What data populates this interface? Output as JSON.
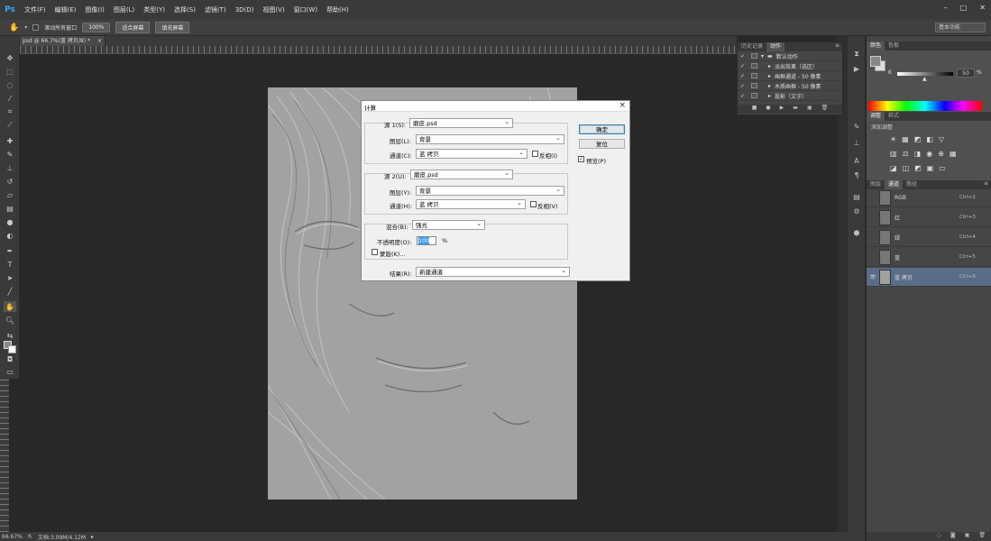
{
  "menubar": {
    "logo": "Ps",
    "items": [
      "文件(F)",
      "编辑(E)",
      "图像(I)",
      "图层(L)",
      "类型(Y)",
      "选择(S)",
      "滤镜(T)",
      "3D(D)",
      "视图(V)",
      "窗口(W)",
      "帮助(H)"
    ],
    "window_controls": [
      "–",
      "□",
      "✕"
    ]
  },
  "optionsbar": {
    "scroll_all_label": "滚动所有窗口",
    "zoom_btn": "100%",
    "fit_btn": "适合屏幕",
    "fill_btn": "填充屏幕",
    "workspace": "基本功能"
  },
  "document": {
    "tab_title": "psd @ 66.7%(蓝 拷贝/8) *",
    "zoom": "66.67%",
    "doc_info": "文档:3.09M/4.12M"
  },
  "actions_panel": {
    "tabs": [
      "历史记录",
      "动作"
    ],
    "active_tab": "动作",
    "rows": [
      {
        "label": "默认动作",
        "level": 0
      },
      {
        "label": "淡出效果（选区）",
        "level": 1
      },
      {
        "label": "画框通道 - 50 像素",
        "level": 1
      },
      {
        "label": "木质画框 - 50 像素",
        "level": 1
      },
      {
        "label": "投影（文字）",
        "level": 1
      }
    ]
  },
  "color_panel": {
    "tabs": [
      "颜色",
      "色板"
    ],
    "k_label": "K",
    "k_value": "50",
    "k_unit": "%"
  },
  "adjust_panel": {
    "tabs": [
      "调整",
      "样式"
    ],
    "title": "添加调整"
  },
  "channels_panel": {
    "tabs": [
      "图层",
      "通道",
      "路径"
    ],
    "channels": [
      {
        "name": "RGB",
        "shortcut": "Ctrl+2"
      },
      {
        "name": "红",
        "shortcut": "Ctrl+3"
      },
      {
        "name": "绿",
        "shortcut": "Ctrl+4"
      },
      {
        "name": "蓝",
        "shortcut": "Ctrl+5"
      },
      {
        "name": "蓝 拷贝",
        "shortcut": "Ctrl+6"
      }
    ]
  },
  "dialog": {
    "title": "计算",
    "source1": {
      "label": "源 1(S):",
      "file": "磨皮.psd",
      "layer_label": "图层(L):",
      "layer": "背景",
      "channel_label": "通道(C):",
      "channel": "蓝 拷贝",
      "invert_label": "反相(I)"
    },
    "source2": {
      "label": "源 2(U):",
      "file": "磨皮.psd",
      "layer_label": "图层(Y):",
      "layer": "背景",
      "channel_label": "通道(H):",
      "channel": "蓝 拷贝",
      "invert_label": "反相(V)"
    },
    "blend_label": "混合(B):",
    "blend": "强光",
    "opacity_label": "不透明度(O):",
    "opacity": "100",
    "opacity_unit": "%",
    "mask_label": "蒙版(K)...",
    "result_label": "结果(R):",
    "result": "新建通道",
    "ok": "确定",
    "reset": "复位",
    "preview_label": "预览(P)"
  }
}
